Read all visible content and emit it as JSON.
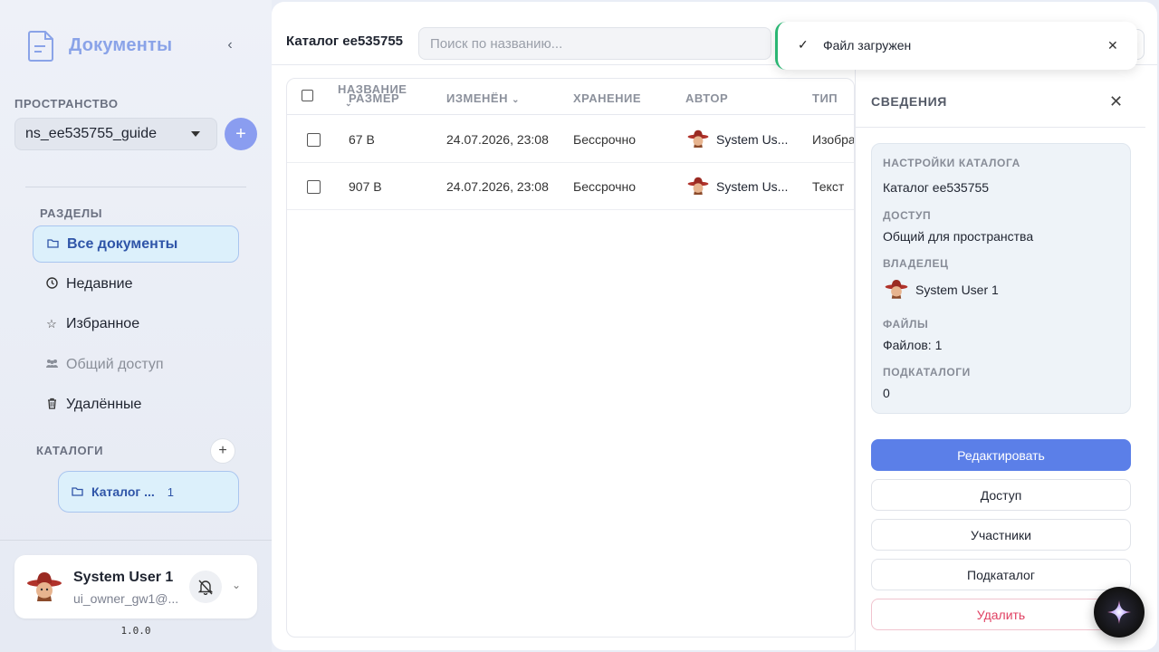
{
  "app": {
    "name": "Документы",
    "version": "1.0.0"
  },
  "sidebar": {
    "space_label": "ПРОСТРАНСТВО",
    "space_value": "ns_ee535755_guide",
    "sections_label": "РАЗДЕЛЫ",
    "items": [
      {
        "label": "Все документы",
        "icon": "folder-icon"
      },
      {
        "label": "Недавние",
        "icon": "clock-icon"
      },
      {
        "label": "Избранное",
        "icon": "star-icon"
      },
      {
        "label": "Общий доступ",
        "icon": "people-icon"
      },
      {
        "label": "Удалённые",
        "icon": "trash-icon"
      }
    ],
    "catalogs_label": "КАТАЛОГИ",
    "catalog": {
      "label": "Каталог ...",
      "count": "1"
    }
  },
  "user": {
    "name": "System User 1",
    "email": "ui_owner_gw1@..."
  },
  "header": {
    "title": "Каталог ee535755",
    "search_placeholder": "Поиск по названию..."
  },
  "table": {
    "headers": {
      "name": "НАЗВАНИЕ",
      "size": "РАЗМЕР",
      "modified": "ИЗМЕНЁН",
      "storage": "ХРАНЕНИЕ",
      "author": "АВТОР",
      "type": "ТИП"
    },
    "rows": [
      {
        "size": "67 B",
        "modified": "24.07.2026, 23:08",
        "storage": "Бессрочно",
        "author": "System Us...",
        "type": "Изобра"
      },
      {
        "size": "907 B",
        "modified": "24.07.2026, 23:08",
        "storage": "Бессрочно",
        "author": "System Us...",
        "type": "Текст"
      }
    ]
  },
  "panel": {
    "title": "СВЕДЕНИЯ",
    "settings_label": "НАСТРОЙКИ КАТАЛОГА",
    "settings_value": "Каталог ee535755",
    "access_label": "ДОСТУП",
    "access_value": "Общий для пространства",
    "owner_label": "ВЛАДЕЛЕЦ",
    "owner_value": "System User 1",
    "files_label": "ФАЙЛЫ",
    "files_value": "Файлов: 1",
    "subcatalogs_label": "ПОДКАТАЛОГИ",
    "subcatalogs_value": "0",
    "buttons": {
      "edit": "Редактировать",
      "access": "Доступ",
      "members": "Участники",
      "subcatalog": "Подкаталог",
      "delete": "Удалить"
    }
  },
  "toast": {
    "message": "Файл загружен"
  },
  "colors": {
    "accent": "#5b7fe8",
    "success": "#2bb673",
    "danger": "#e04062",
    "active_bg": "#dcf0fb"
  }
}
